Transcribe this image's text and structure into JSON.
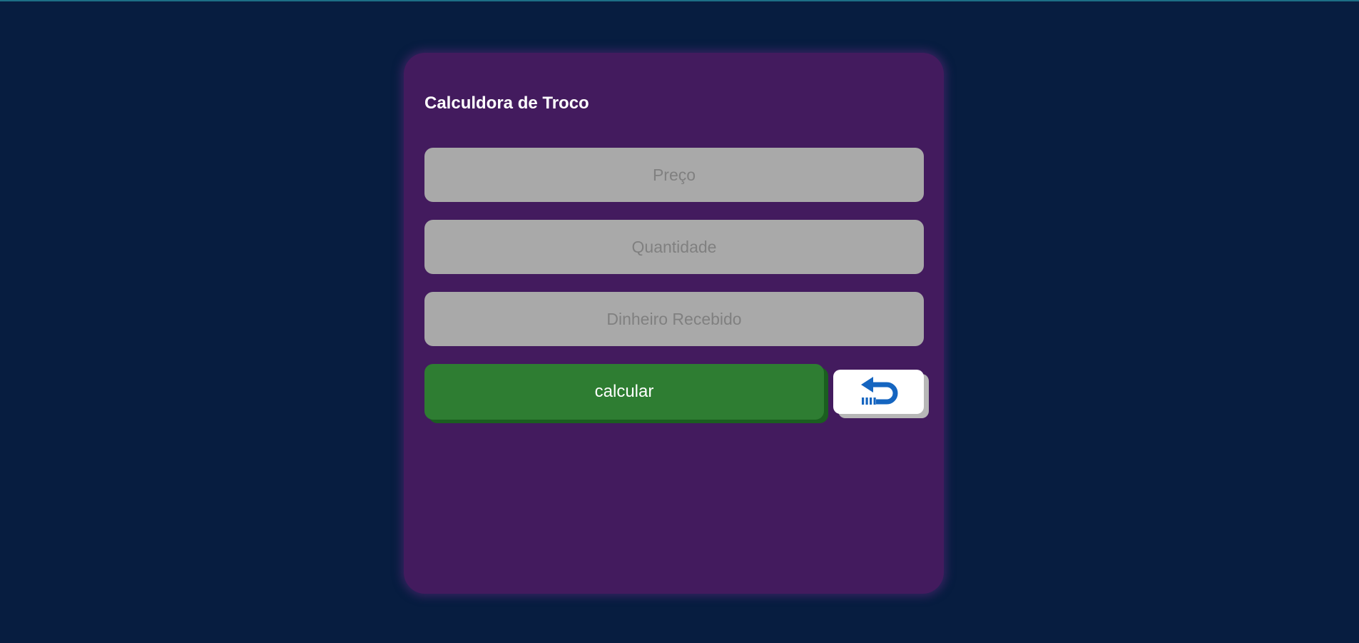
{
  "app": {
    "title": "Calculdora de Troco"
  },
  "form": {
    "price": {
      "placeholder": "Preço",
      "value": ""
    },
    "quantity": {
      "placeholder": "Quantidade",
      "value": ""
    },
    "cash_received": {
      "placeholder": "Dinheiro Recebido",
      "value": ""
    }
  },
  "actions": {
    "calculate_label": "calcular",
    "back_icon": "undo-arrow-icon"
  },
  "colors": {
    "background": "#071d40",
    "card": "#431b5e",
    "input": "#a9a9a9",
    "primary_button": "#2e7d32",
    "icon": "#1565c0"
  }
}
